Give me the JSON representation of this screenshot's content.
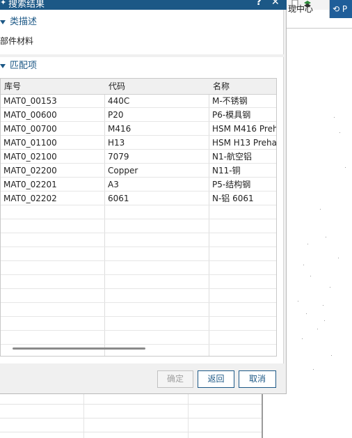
{
  "dialog": {
    "title": "搜索结果",
    "help_label": "?",
    "close_label": "✕"
  },
  "background": {
    "tabs": [
      "现中心",
      "P"
    ]
  },
  "section_desc": {
    "header": "类描述",
    "text": "部件材料"
  },
  "section_match": {
    "header": "匹配项",
    "columns": [
      "库号",
      "代码",
      "名称"
    ],
    "rows": [
      [
        "MAT0_00153",
        "440C",
        "M-不锈钢"
      ],
      [
        "MAT0_00600",
        "P20",
        "P6-模具钢"
      ],
      [
        "MAT0_00700",
        "M416",
        "HSM M416 Preh"
      ],
      [
        "MAT0_01100",
        "H13",
        "HSM H13 Preha"
      ],
      [
        "MAT0_02100",
        "7079",
        "N1-航空铝"
      ],
      [
        "MAT0_02200",
        "Copper",
        "N11-铜"
      ],
      [
        "MAT0_02201",
        "A3",
        "P5-结构钢"
      ],
      [
        "MAT0_02202",
        "6061",
        "N-铝 6061"
      ]
    ]
  },
  "buttons": {
    "ok": "确定",
    "back": "返回",
    "cancel": "取消"
  }
}
